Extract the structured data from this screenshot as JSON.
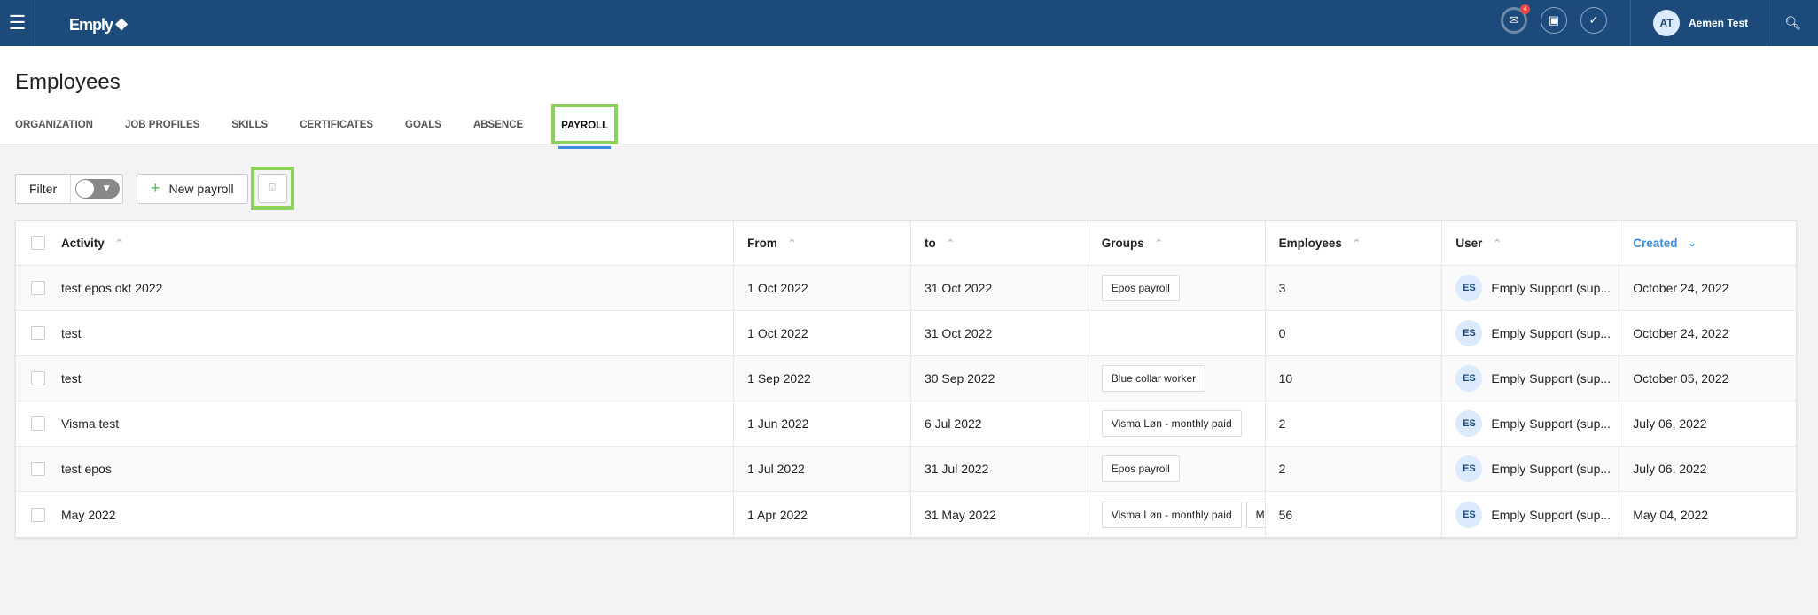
{
  "topbar": {
    "logo": "Emply",
    "badge": "4",
    "user_initials": "AT",
    "user_name": "Aemen Test"
  },
  "page": {
    "title": "Employees"
  },
  "tabs": [
    "ORGANIZATION",
    "JOB PROFILES",
    "SKILLS",
    "CERTIFICATES",
    "GOALS",
    "ABSENCE",
    "PAYROLL"
  ],
  "active_tab": "PAYROLL",
  "toolbar": {
    "filter_label": "Filter",
    "new_payroll_label": "New payroll"
  },
  "colors": {
    "header": "#1c4b7b",
    "accent": "#3b8de0",
    "highlight": "#8dd05a"
  },
  "table": {
    "headers": [
      "Activity",
      "From",
      "to",
      "Groups",
      "Employees",
      "User",
      "Created"
    ],
    "rows": [
      {
        "activity": "test epos okt 2022",
        "from": "1 Oct 2022",
        "to": "31 Oct 2022",
        "groups": [
          "Epos payroll"
        ],
        "employees": "3",
        "user_initials": "ES",
        "user": "Emply Support (sup...",
        "created": "October 24, 2022"
      },
      {
        "activity": "test",
        "from": "1 Oct 2022",
        "to": "31 Oct 2022",
        "groups": [],
        "employees": "0",
        "user_initials": "ES",
        "user": "Emply Support (sup...",
        "created": "October 24, 2022"
      },
      {
        "activity": "test",
        "from": "1 Sep 2022",
        "to": "30 Sep 2022",
        "groups": [
          "Blue collar worker"
        ],
        "employees": "10",
        "user_initials": "ES",
        "user": "Emply Support (sup...",
        "created": "October 05, 2022"
      },
      {
        "activity": "Visma test",
        "from": "1 Jun 2022",
        "to": "6 Jul 2022",
        "groups": [
          "Visma Løn - monthly paid"
        ],
        "employees": "2",
        "user_initials": "ES",
        "user": "Emply Support (sup...",
        "created": "July 06, 2022"
      },
      {
        "activity": "test epos",
        "from": "1 Jul 2022",
        "to": "31 Jul 2022",
        "groups": [
          "Epos payroll"
        ],
        "employees": "2",
        "user_initials": "ES",
        "user": "Emply Support (sup...",
        "created": "July 06, 2022"
      },
      {
        "activity": "May 2022",
        "from": "1 Apr 2022",
        "to": "31 May 2022",
        "groups": [
          "Visma Løn - monthly paid",
          "Mo"
        ],
        "employees": "56",
        "user_initials": "ES",
        "user": "Emply Support (sup...",
        "created": "May 04, 2022"
      }
    ]
  }
}
